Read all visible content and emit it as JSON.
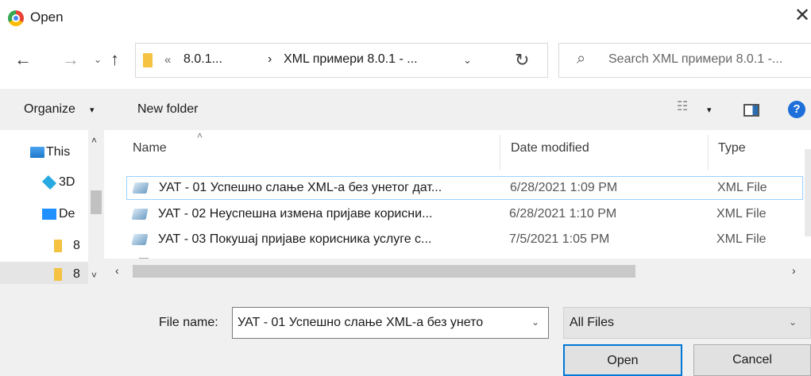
{
  "window": {
    "title": "Open",
    "close_glyph": "✕"
  },
  "nav": {
    "back_glyph": "←",
    "forward_glyph": "→",
    "recent_glyph": "⌄",
    "up_glyph": "↑",
    "breadcrumb_overflow": "«",
    "crumbs": [
      "8.0.1...",
      "XML примери 8.0.1 - ..."
    ],
    "crumb_separator": "›",
    "dropdown_glyph": "⌄",
    "refresh_glyph": "↻",
    "search_placeholder": "Search XML примери 8.0.1 -..."
  },
  "toolbar": {
    "organize_label": "Organize",
    "caret": "▾",
    "new_folder_label": "New folder",
    "help_label": "?"
  },
  "sidebar": {
    "items": [
      {
        "label": "This",
        "icon": "this-pc-icon"
      },
      {
        "label": "3D",
        "icon": "3d-objects-icon"
      },
      {
        "label": "De",
        "icon": "desktop-icon"
      },
      {
        "label": "8",
        "icon": "folder-icon"
      },
      {
        "label": "8",
        "icon": "folder-icon"
      }
    ],
    "scroll_up": "˄",
    "scroll_down": "˅"
  },
  "files": {
    "columns": {
      "name": "Name",
      "date": "Date modified",
      "type": "Type"
    },
    "sort_glyph": "˄",
    "rows": [
      {
        "name": "УАТ - 01 Успешно слање XML-а без унетог дат...",
        "date": "6/28/2021 1:09 PM",
        "type": "XML File",
        "selected": true
      },
      {
        "name": "УАТ - 02 Неуспешна измена пријаве корисни...",
        "date": "6/28/2021 1:10 PM",
        "type": "XML File",
        "selected": false
      },
      {
        "name": "УАТ - 03 Покушај пријаве корисника услуге с...",
        "date": "7/5/2021 1:05 PM",
        "type": "XML File",
        "selected": false
      }
    ]
  },
  "hscroll": {
    "left_glyph": "‹",
    "right_glyph": "›"
  },
  "footer": {
    "file_name_label": "File name:",
    "file_name_value": "УАТ - 01 Успешно слање XML-а без унето",
    "dropdown_glyph": "⌄",
    "filter_value": "All Files",
    "open_label": "Open",
    "cancel_label": "Cancel"
  }
}
